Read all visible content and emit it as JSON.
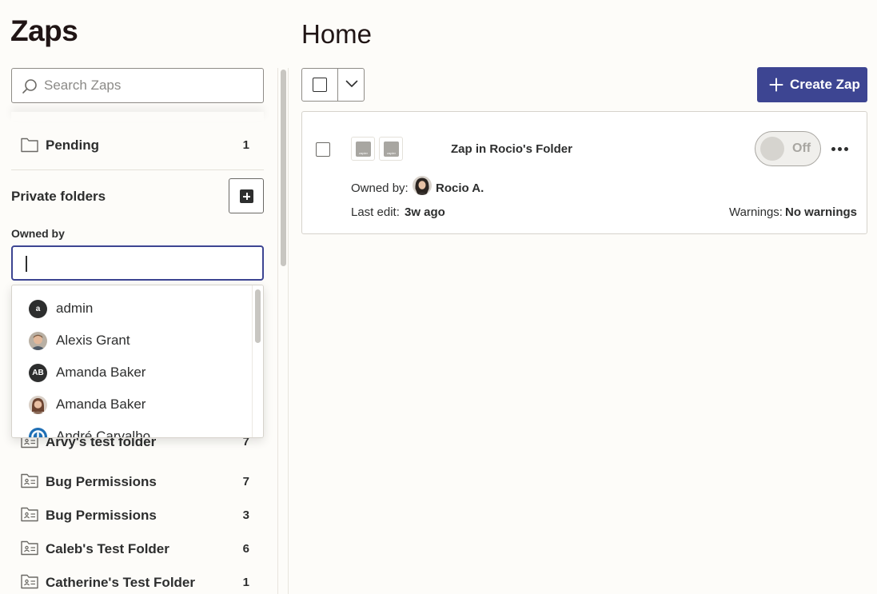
{
  "sidebar": {
    "title": "Zaps",
    "search": {
      "placeholder": "Search Zaps",
      "value": ""
    },
    "pending": {
      "label": "Pending",
      "count": "1"
    },
    "private_folders_label": "Private folders",
    "owned_by": {
      "label": "Owned by",
      "value": "",
      "options": [
        {
          "name": "admin",
          "avatar_initials": "a"
        },
        {
          "name": "Alexis Grant",
          "avatar_initials": ""
        },
        {
          "name": "Amanda Baker",
          "avatar_initials": "AB"
        },
        {
          "name": "Amanda Baker",
          "avatar_initials": ""
        },
        {
          "name": "André Carvalho",
          "avatar_initials": ""
        }
      ]
    },
    "folders": [
      {
        "label": "Arvy's test folder",
        "count": "7"
      },
      {
        "label": "Bug Permissions",
        "count": "7"
      },
      {
        "label": "Bug Permissions",
        "count": "3"
      },
      {
        "label": "Caleb's Test Folder",
        "count": "6"
      },
      {
        "label": "Catherine's Test Folder",
        "count": "1"
      }
    ]
  },
  "main": {
    "title": "Home",
    "create_button": "Create Zap",
    "zaps": [
      {
        "name": "Zap in Rocio's Folder",
        "app_icons": [
          "zapier",
          "zapier"
        ],
        "status": "Off",
        "owned_by_label": "Owned by:",
        "owner": "Rocio A.",
        "last_edit_label": "Last edit:",
        "last_edit": "3w ago",
        "warnings_label": "Warnings:",
        "warnings": "No warnings"
      }
    ]
  },
  "colors": {
    "accent": "#3d4592",
    "background": "#fdfcf9",
    "text": "#2d2e2e"
  }
}
